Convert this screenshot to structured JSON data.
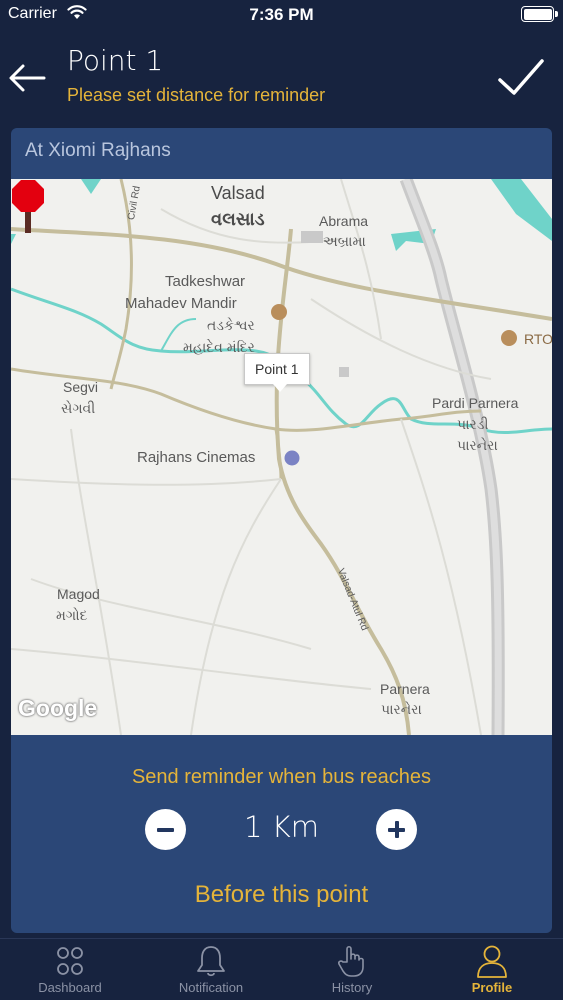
{
  "status_bar": {
    "carrier": "Carrier",
    "time": "7:36 PM"
  },
  "header": {
    "title": "Point 1",
    "subtitle": "Please set distance for reminder",
    "back_icon": "arrow-left-icon",
    "confirm_icon": "checkmark-icon"
  },
  "card": {
    "title": "At Xiomi Rajhans"
  },
  "map": {
    "labels": {
      "valsad": "Valsad",
      "valsad_gu": "વલસાડ",
      "abrama": "Abrama",
      "abrama_gu": "અબ્રામા",
      "civil_rd": "Civil Rd",
      "tadkeshwar_1": "Tadkeshwar",
      "tadkeshwar_2": "Mahadev Mandir",
      "tadkeshwar_gu_1": "તડકેશ્વર",
      "tadkeshwar_gu_2": "મહાદેવ મંદિર",
      "rto": "RTO",
      "segvi": "Segvi",
      "segvi_gu": "સેગવી",
      "pardi": "Pardi Parnera",
      "pardi_gu_1": "પારડી",
      "pardi_gu_2": "પારનેરા",
      "cinema": "Rajhans Cinemas",
      "magod": "Magod",
      "magod_gu": "મગોદ",
      "atul_rd": "Valsad-Atul Rd",
      "parnera": "Parnera",
      "parnera_gu": "પારનેરા"
    },
    "marker_label": "Point 1",
    "marker_color": "#e3000f",
    "attribution": "Google"
  },
  "reminder": {
    "prompt": "Send reminder when bus reaches",
    "distance": "1 Km",
    "suffix": "Before this point",
    "decrease_icon": "minus-circle-icon",
    "increase_icon": "plus-circle-icon"
  },
  "tabbar": {
    "tabs": [
      {
        "label": "Dashboard",
        "icon": "grid-dots-icon",
        "active": false
      },
      {
        "label": "Notification",
        "icon": "bell-icon",
        "active": false
      },
      {
        "label": "History",
        "icon": "hand-pointer-icon",
        "active": false
      },
      {
        "label": "Profile",
        "icon": "user-icon",
        "active": true
      }
    ]
  },
  "colors": {
    "background": "#17233f",
    "card": "#2b4777",
    "accent": "#e5b43a"
  }
}
